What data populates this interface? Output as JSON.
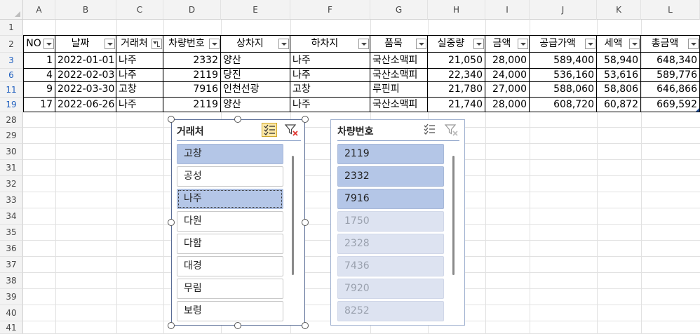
{
  "columns": [
    "A",
    "B",
    "C",
    "D",
    "E",
    "F",
    "G",
    "H",
    "I",
    "J",
    "K",
    "L"
  ],
  "rows": [
    "1",
    "2",
    "3",
    "6",
    "11",
    "19",
    "28",
    "29",
    "30",
    "31",
    "32",
    "33",
    "34",
    "35",
    "36",
    "37",
    "38",
    "39",
    "40",
    "41"
  ],
  "table": {
    "headers": [
      "NO",
      "날짜",
      "거래처",
      "차량번호",
      "상차지",
      "하차지",
      "품목",
      "실중량",
      "금액",
      "공급가액",
      "세액",
      "총금액"
    ],
    "data": [
      [
        "1",
        "2022-01-01",
        "나주",
        "2332",
        "양산",
        "나주",
        "국산소맥피",
        "21,050",
        "28,000",
        "589,400",
        "58,940",
        "648,340"
      ],
      [
        "4",
        "2022-02-03",
        "나주",
        "2119",
        "당진",
        "나주",
        "국산소맥피",
        "22,340",
        "24,000",
        "536,160",
        "53,616",
        "589,776"
      ],
      [
        "9",
        "2022-03-30",
        "고창",
        "7916",
        "인천선광",
        "고창",
        "루핀피",
        "21,780",
        "27,000",
        "588,060",
        "58,806",
        "646,866"
      ],
      [
        "17",
        "2022-06-26",
        "나주",
        "2119",
        "양산",
        "나주",
        "국산소맥피",
        "21,740",
        "28,000",
        "608,720",
        "60,872",
        "669,592"
      ]
    ]
  },
  "slicer1": {
    "title": "거래처",
    "items": [
      {
        "label": "고창",
        "state": "sel"
      },
      {
        "label": "공성",
        "state": "normal"
      },
      {
        "label": "나주",
        "state": "sel"
      },
      {
        "label": "다원",
        "state": "normal"
      },
      {
        "label": "다함",
        "state": "normal"
      },
      {
        "label": "대경",
        "state": "normal"
      },
      {
        "label": "무림",
        "state": "normal"
      },
      {
        "label": "보령",
        "state": "normal"
      }
    ]
  },
  "slicer2": {
    "title": "차량번호",
    "items": [
      {
        "label": "2119",
        "state": "sel"
      },
      {
        "label": "2332",
        "state": "sel"
      },
      {
        "label": "7916",
        "state": "sel"
      },
      {
        "label": "1750",
        "state": "nodata"
      },
      {
        "label": "2328",
        "state": "nodata"
      },
      {
        "label": "7436",
        "state": "nodata"
      },
      {
        "label": "7920",
        "state": "nodata"
      },
      {
        "label": "8252",
        "state": "nodata"
      }
    ]
  },
  "icons": {
    "multiselect": "multi-select-icon",
    "clearfilter": "clear-filter-icon"
  },
  "colors": {
    "selected": "#b4c6e7",
    "nodata": "#dde3f1",
    "active_row_header": "#1f5fbf"
  }
}
